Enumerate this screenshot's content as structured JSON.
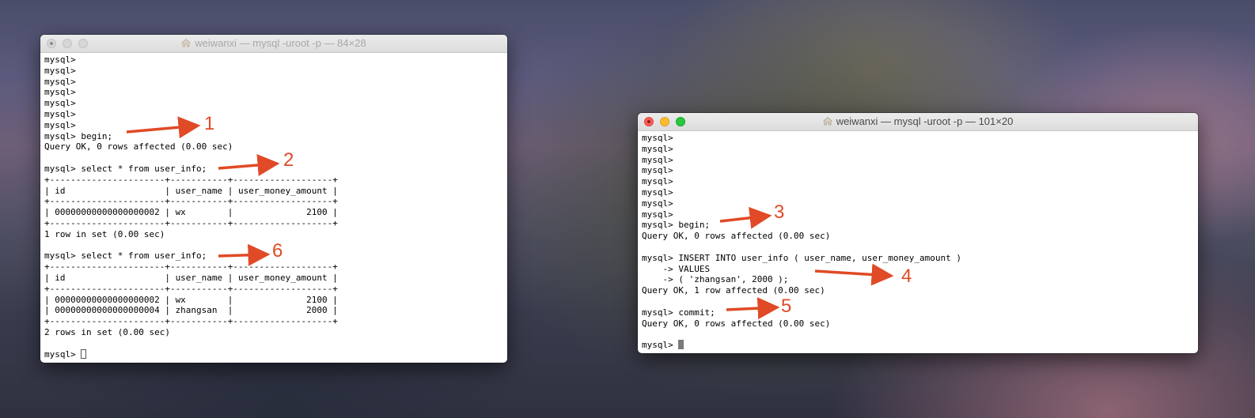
{
  "left_terminal": {
    "title": "weiwanxi — mysql -uroot -p — 84×28",
    "lines": [
      "mysql>",
      "mysql>",
      "mysql>",
      "mysql>",
      "mysql>",
      "mysql>",
      "mysql>",
      "mysql> begin;",
      "Query OK, 0 rows affected (0.00 sec)",
      "",
      "mysql> select * from user_info;",
      "+----------------------+-----------+-------------------+",
      "| id                   | user_name | user_money_amount |",
      "+----------------------+-----------+-------------------+",
      "| 00000000000000000002 | wx        |              2100 |",
      "+----------------------+-----------+-------------------+",
      "1 row in set (0.00 sec)",
      "",
      "mysql> select * from user_info;",
      "+----------------------+-----------+-------------------+",
      "| id                   | user_name | user_money_amount |",
      "+----------------------+-----------+-------------------+",
      "| 00000000000000000002 | wx        |              2100 |",
      "| 00000000000000000004 | zhangsan  |              2000 |",
      "+----------------------+-----------+-------------------+",
      "2 rows in set (0.00 sec)",
      "",
      "mysql> "
    ]
  },
  "right_terminal": {
    "title": "weiwanxi — mysql -uroot -p — 101×20",
    "lines": [
      "mysql>",
      "mysql>",
      "mysql>",
      "mysql>",
      "mysql>",
      "mysql>",
      "mysql>",
      "mysql>",
      "mysql> begin;",
      "Query OK, 0 rows affected (0.00 sec)",
      "",
      "mysql> INSERT INTO user_info ( user_name, user_money_amount )",
      "    -> VALUES",
      "    -> ( 'zhangsan', 2000 );",
      "Query OK, 1 row affected (0.00 sec)",
      "",
      "mysql> commit;",
      "Query OK, 0 rows affected (0.00 sec)",
      "",
      "mysql> "
    ]
  },
  "annotations": [
    {
      "label": "1"
    },
    {
      "label": "2"
    },
    {
      "label": "3"
    },
    {
      "label": "4"
    },
    {
      "label": "5"
    },
    {
      "label": "6"
    }
  ],
  "colors": {
    "annotation": "#e04a26",
    "close_red": "#fe5f57",
    "minimize_yellow": "#febc2e",
    "zoom_green": "#28c840"
  },
  "icons": [
    "home-folder-icon",
    "close-icon",
    "minimize-icon",
    "zoom-icon"
  ]
}
